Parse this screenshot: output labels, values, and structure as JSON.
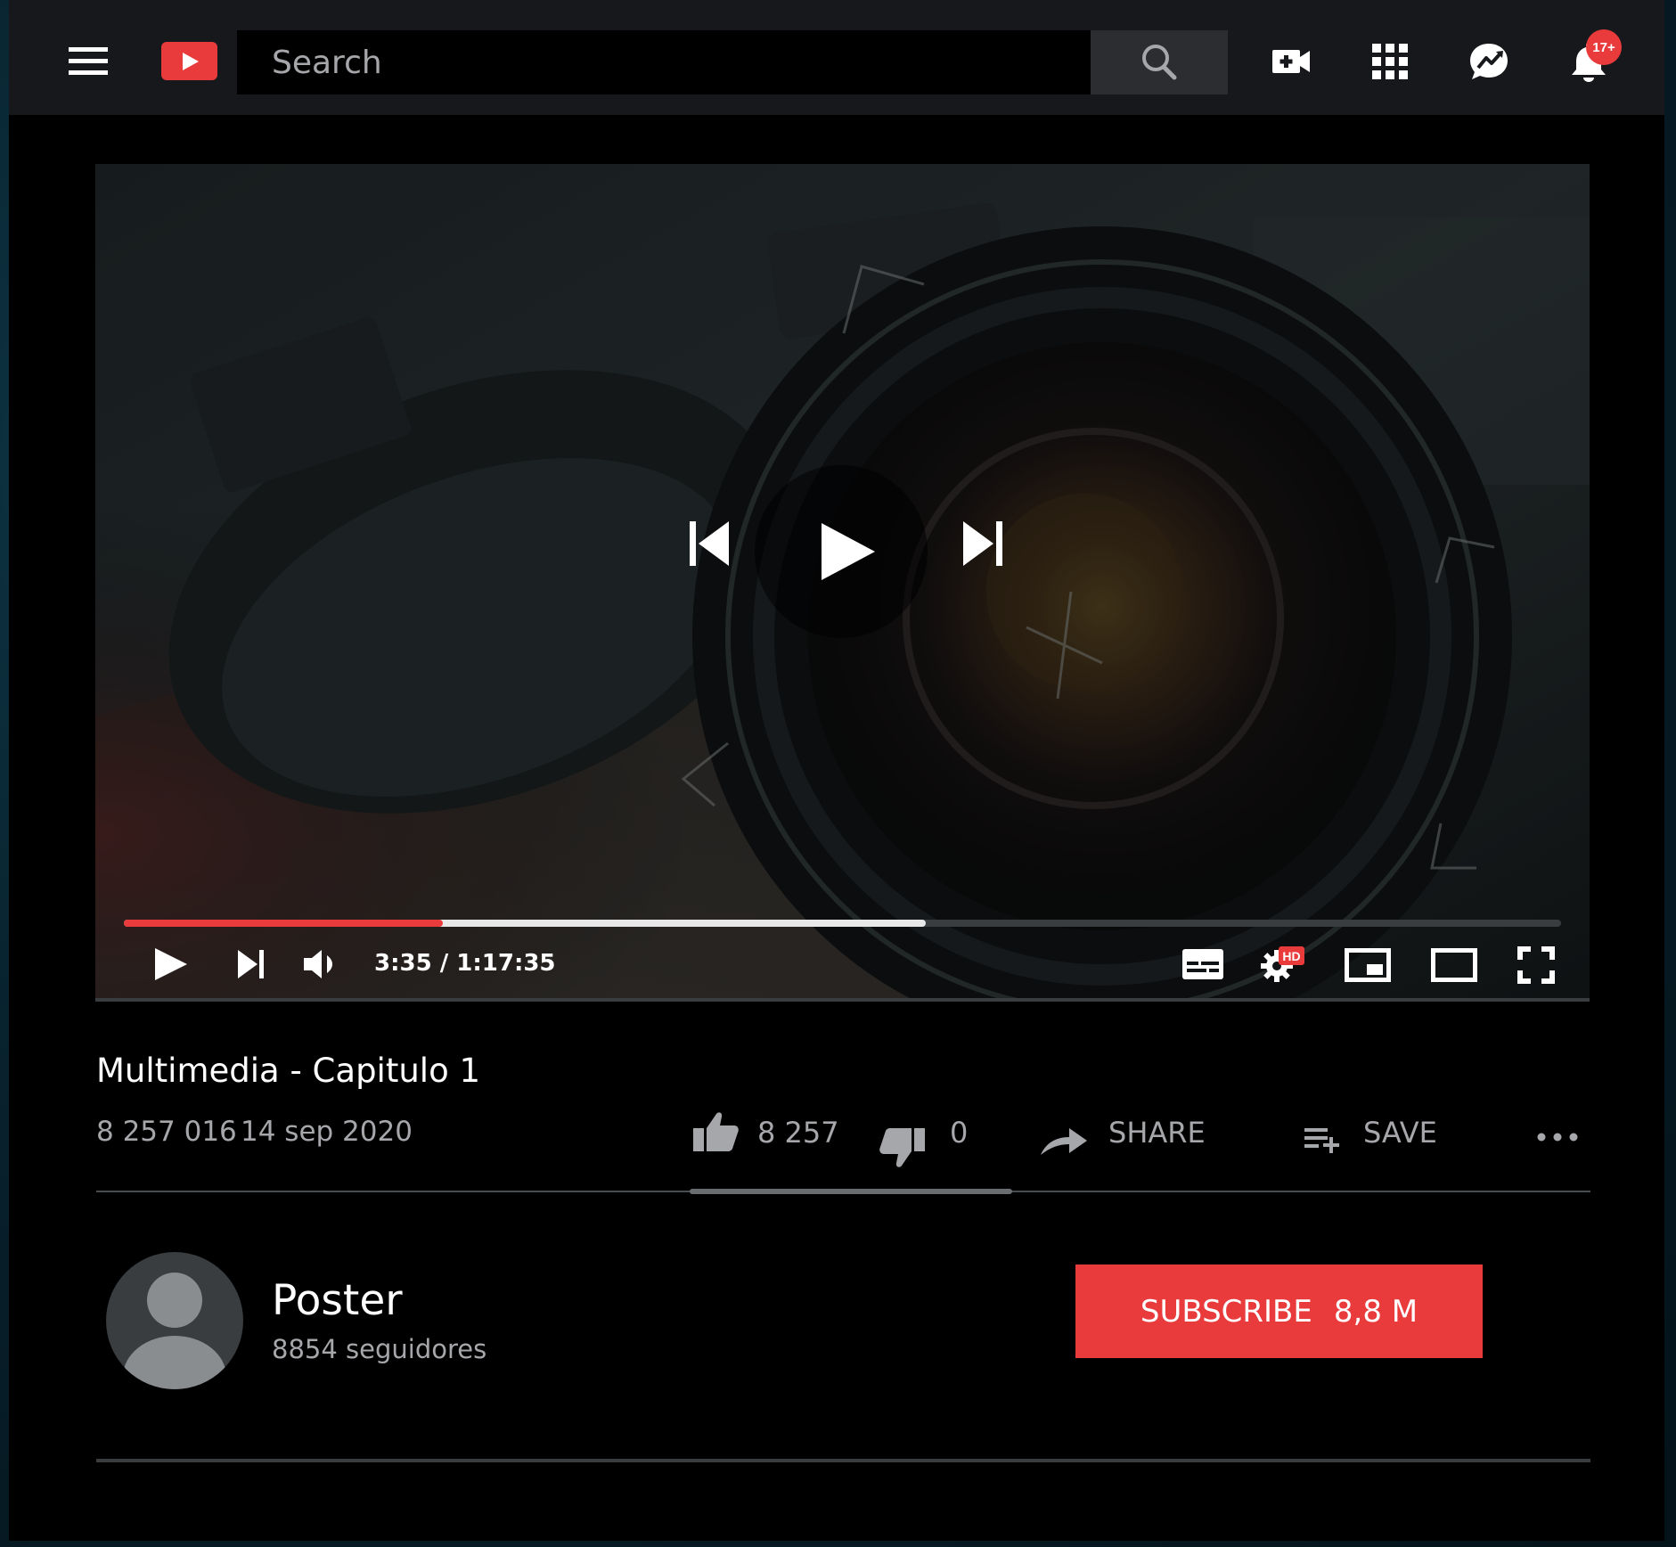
{
  "colors": {
    "accent": "#e93a3c",
    "topbar": "#16181b",
    "background": "#000000",
    "muted_text": "#a5a7aa"
  },
  "header": {
    "search_placeholder": "Search",
    "icons": [
      "menu-icon",
      "logo-play-icon",
      "search-icon",
      "add-video-icon",
      "apps-grid-icon",
      "messages-icon",
      "bell-icon"
    ],
    "notifications_badge": "17+"
  },
  "player": {
    "time": "3:35 / 1:17:35",
    "progress_played_fraction": 0.222,
    "progress_buffered_fraction": 0.558,
    "quality_badge": "HD",
    "icons": [
      "previous-icon",
      "play-icon",
      "next-icon",
      "volume-icon",
      "subtitles-icon",
      "settings-icon",
      "miniplayer-icon",
      "theater-icon",
      "fullscreen-icon"
    ]
  },
  "video": {
    "title": "Multimedia - Capitulo 1",
    "views": "8 257 016",
    "date": "14 sep 2020",
    "likes": "8 257",
    "dislikes": "0",
    "share_label": "SHARE",
    "save_label": "SAVE"
  },
  "channel": {
    "name": "Poster",
    "followers": "8854 seguidores",
    "subscribe_label": "SUBSCRIBE",
    "subscribe_count": "8,8 M"
  }
}
